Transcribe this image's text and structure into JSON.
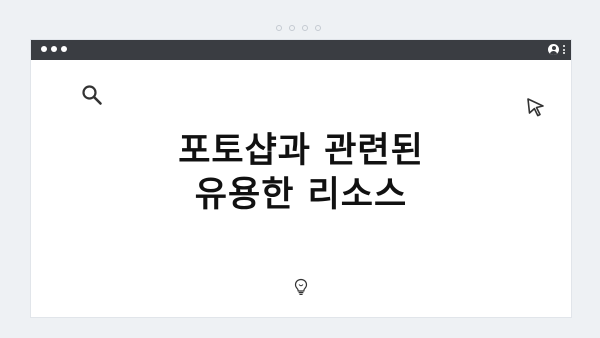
{
  "headline": {
    "line1": "포토샵과 관련된",
    "line2": "유용한 리소스"
  },
  "icons": {
    "search": "search-icon",
    "cursor": "cursor-arrow-icon",
    "lightbulb": "lightbulb-icon",
    "user": "user-icon",
    "menu": "kebab-menu-icon"
  },
  "colors": {
    "background": "#eef1f4",
    "titlebar": "#3a3d42",
    "window": "#ffffff",
    "text": "#111111"
  }
}
